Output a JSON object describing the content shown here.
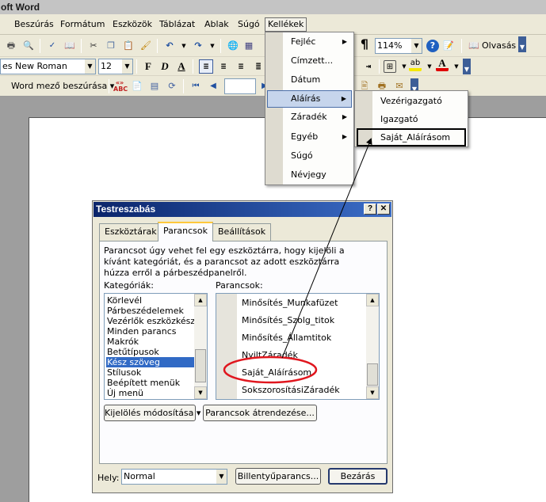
{
  "window": {
    "title": "oft Word"
  },
  "menubar": {
    "items": [
      "Beszúrás",
      "Formátum",
      "Eszközök",
      "Táblázat",
      "Ablak",
      "Súgó",
      "Kellékek"
    ]
  },
  "toolbar_standard": {
    "zoom": "114%",
    "read_label": "Olvasás"
  },
  "toolbar_formatting": {
    "font_name": "es New Roman",
    "font_size": "12",
    "bold": "F",
    "italic": "D",
    "underline": "A"
  },
  "toolbar_field": {
    "insert_field_label": "Word mező beszúrása ▾"
  },
  "kellekek_menu": {
    "items": [
      {
        "label": "Fejléc",
        "has_submenu": true
      },
      {
        "label": "Címzett...",
        "has_submenu": false
      },
      {
        "label": "Dátum",
        "has_submenu": false
      },
      {
        "label": "Aláírás",
        "has_submenu": true
      },
      {
        "label": "Záradék",
        "has_submenu": true
      },
      {
        "label": "Egyéb",
        "has_submenu": true
      },
      {
        "label": "Súgó",
        "has_submenu": false
      },
      {
        "label": "Névjegy",
        "has_submenu": false
      }
    ],
    "highlighted_index": 3
  },
  "alairas_submenu": {
    "items": [
      "Vezérigazgató",
      "Igazgató",
      "Saját_Aláírásom"
    ],
    "boxed_index": 2
  },
  "dialog": {
    "title": "Testreszabás",
    "help_btn": "?",
    "close_btn": "✕",
    "tabs": [
      "Eszköztárak",
      "Parancsok",
      "Beállítások"
    ],
    "active_tab": 1,
    "description": "Parancsot úgy vehet fel egy eszköztárra, hogy kijelöli a kívánt kategóriát, és a parancsot az adott eszköztárra húzza erről a párbeszédpanelről.",
    "categories_label": "Kategóriák:",
    "commands_label": "Parancsok:",
    "categories": [
      "Körlevél",
      "Párbeszédelemek",
      "Vezérlők eszközkészlet",
      "Minden parancs",
      "Makrók",
      "Betűtípusok",
      "Kész szöveg",
      "Stílusok",
      "Beépített menük",
      "Új menü"
    ],
    "selected_category": 6,
    "commands": [
      "Minősítés_Munkafüzet",
      "Minősítés_Szolg_titok",
      "Minősítés_Államtitok",
      "NyiltZáradék",
      "Saját_Aláírásom",
      "SokszorosításiZáradék"
    ],
    "circled_command": 4,
    "modify_selection_label": "Kijelölés módosítása ▾",
    "rearrange_label": "Parancsok átrendezése...",
    "location_label": "Hely:",
    "location_value": "Normal",
    "keyboard_label": "Billentyűparancs...",
    "close_label": "Bezárás"
  },
  "colors": {
    "menu_highlight": "#c6d5ec",
    "dialog_title": "#0a246a",
    "selection": "#316ac5",
    "circle": "#e0161e"
  }
}
